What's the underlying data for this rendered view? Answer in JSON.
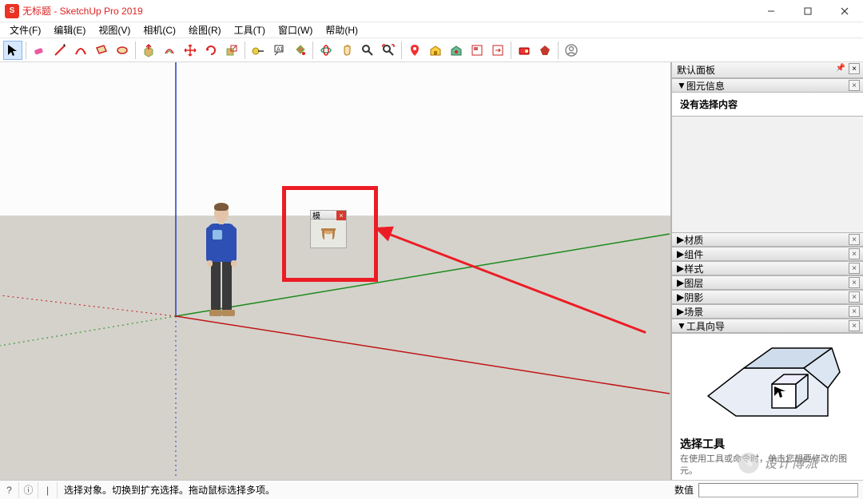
{
  "window": {
    "title": "无标题 - SketchUp Pro 2019"
  },
  "menu": [
    "文件(F)",
    "编辑(E)",
    "视图(V)",
    "相机(C)",
    "绘图(R)",
    "工具(T)",
    "窗口(W)",
    "帮助(H)"
  ],
  "toolbar_icons": [
    "select-arrow",
    "eraser",
    "line",
    "arc",
    "rectangle",
    "circle",
    "push-pull",
    "offset",
    "move",
    "rotate",
    "scale",
    "tape-measure",
    "text-label",
    "paint-bucket",
    "orbit",
    "pan",
    "zoom",
    "zoom-extents",
    "add-location",
    "3d-warehouse",
    "extension-warehouse",
    "layouttool",
    "send-to-layout",
    "extensions",
    "ruby-diamond",
    "user-account"
  ],
  "mini_palette": {
    "title": "模"
  },
  "tray": {
    "header": "默认面板",
    "entity_panel": {
      "title": "图元信息",
      "content": "没有选择内容"
    },
    "collapsed": [
      "材质",
      "组件",
      "样式",
      "图层",
      "阴影",
      "场景"
    ],
    "instructor_panel": "工具向导",
    "instructor_title": "选择工具",
    "instructor_text": "在使用工具或命令时，单击您想要修改的图元。"
  },
  "statusbar": {
    "hint": "选择对象。切换到扩充选择。拖动鼠标选择多项。",
    "value_label": "数值"
  },
  "watermark": "设计博派"
}
